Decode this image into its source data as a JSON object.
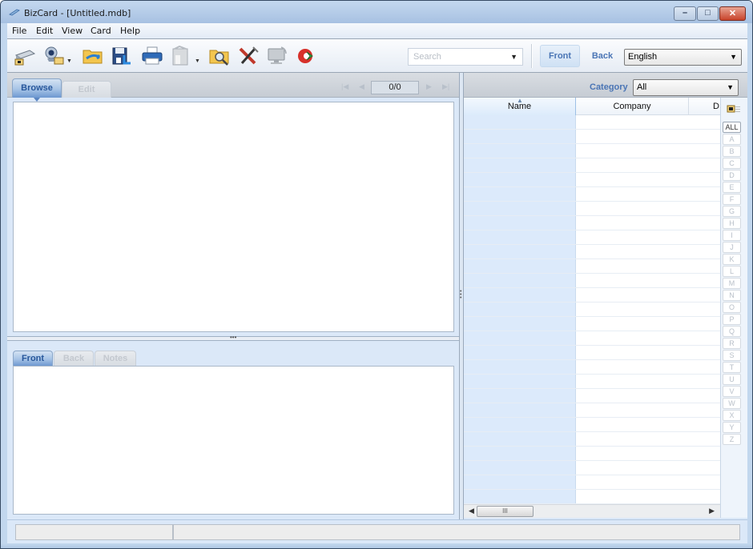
{
  "window": {
    "title": "BizCard - [Untitled.mdb]",
    "controls": {
      "minimize": "–",
      "maximize": "□",
      "close": "✕"
    }
  },
  "menu": [
    "File",
    "Edit",
    "View",
    "Card",
    "Help"
  ],
  "toolbar": {
    "icons": [
      "scanner-icon",
      "webcam-icon",
      "open-folder-icon",
      "save-icon",
      "print-icon",
      "export-icon",
      "search-folder-icon",
      "tools-icon",
      "display-icon",
      "activate-icon"
    ],
    "search_placeholder": "Search",
    "front_label": "Front",
    "back_label": "Back",
    "language": "English"
  },
  "browse": {
    "tabs": [
      "Browse",
      "Edit"
    ],
    "active_tab": "Browse",
    "counter": "0/0",
    "nav": {
      "first": "⏮",
      "prev": "◀",
      "next": "▶",
      "last": "⏭"
    }
  },
  "card_view": {
    "tabs": [
      "Front",
      "Back",
      "Notes"
    ],
    "active_tab": "Front"
  },
  "list": {
    "category_label": "Category",
    "category_value": "All",
    "columns": [
      "Name",
      "Company",
      "D"
    ],
    "sort_column": "Name",
    "row_count_visible": 27,
    "scroll_thumb_label": "III"
  },
  "alphabet": [
    "ALL",
    "A",
    "B",
    "C",
    "D",
    "E",
    "F",
    "G",
    "H",
    "I",
    "J",
    "K",
    "L",
    "M",
    "N",
    "O",
    "P",
    "Q",
    "R",
    "S",
    "T",
    "U",
    "V",
    "W",
    "X",
    "Y",
    "Z"
  ],
  "status": [
    "",
    ""
  ]
}
